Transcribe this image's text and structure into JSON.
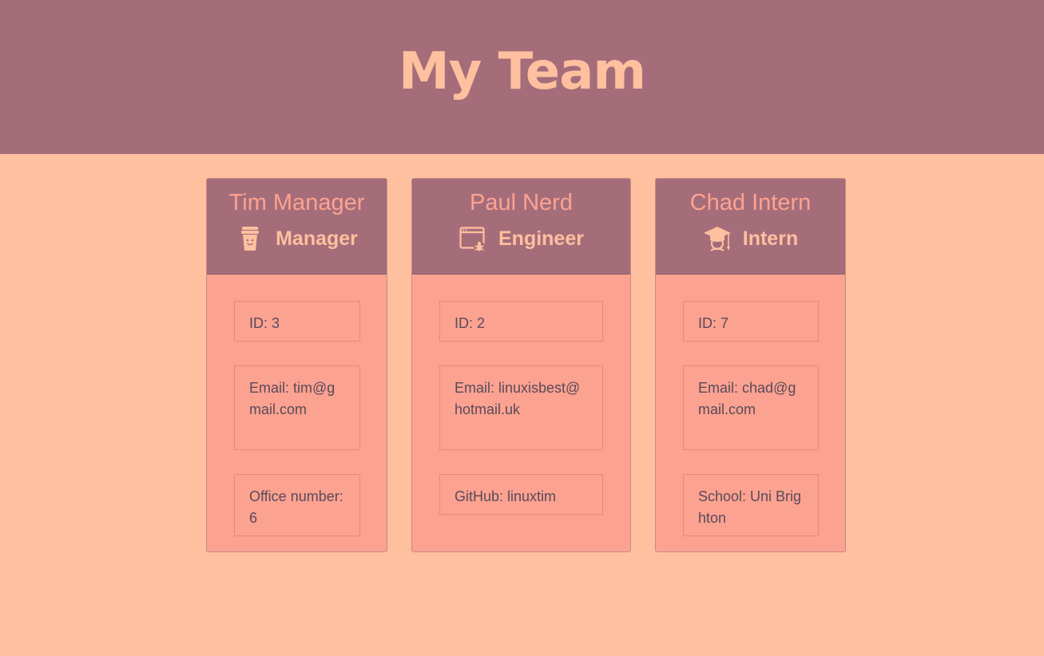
{
  "header": {
    "title": "My Team"
  },
  "team": [
    {
      "name": "Tim Manager",
      "role": "Manager",
      "role_icon": "coffee-cup-icon",
      "id_text": "ID: 3",
      "email_text": "Email: tim@gmail.com",
      "extra_text": "Office number: 6"
    },
    {
      "name": "Paul Nerd",
      "role": "Engineer",
      "role_icon": "bug-window-icon",
      "id_text": "ID: 2",
      "email_text": "Email: linuxisbest@hotmail.uk",
      "extra_text": "GitHub: linuxtim"
    },
    {
      "name": "Chad Intern",
      "role": "Intern",
      "role_icon": "graduate-icon",
      "id_text": "ID: 7",
      "email_text": "Email: chad@gmail.com",
      "extra_text": "School: Uni Brighton"
    }
  ],
  "colors": {
    "background": "#ffc09f",
    "header": "#a56d7a",
    "card_body": "#fca290",
    "text": "#5a4a5c"
  }
}
